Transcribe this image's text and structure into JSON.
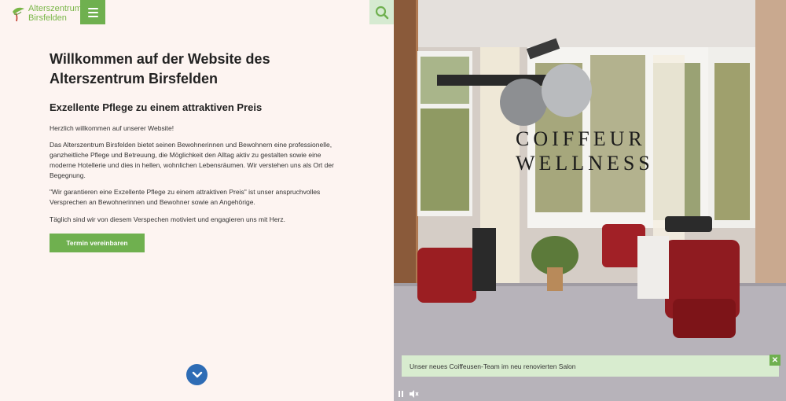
{
  "header": {
    "logo_line1": "Alterszentrum",
    "logo_line2": "Birsfelden",
    "menu_icon": "hamburger-menu-icon",
    "search_icon": "search-icon"
  },
  "main": {
    "headline": "Willkommen auf der Website des Alterszentrum Birsfelden",
    "subheadline": "Exzellente Pflege zu einem attraktiven Preis",
    "paragraphs": [
      "Herzlich willkommen auf unserer Website!",
      "Das Alterszentrum Birsfelden bietet seinen Bewohnerinnen und Bewohnern eine professionelle, ganzheitliche Pflege und Betreuung, die Möglichkeit den Alltag aktiv zu gestalten sowie eine moderne Hotellerie und dies in hellen, wohnlichen Lebensräumen. Wir verstehen uns als Ort der Begegnung.",
      "\"Wir garantieren eine Exzellente Pflege zu einem attraktiven Preis\" ist unser anspruchvolles Versprechen an Bewohnerinnen und Bewohner sowie an Angehörige.",
      "Täglich sind wir von diesem Verspechen motiviert und engagieren uns mit Herz."
    ],
    "cta_label": "Termin vereinbaren",
    "scroll_icon": "chevron-down-icon"
  },
  "hero": {
    "title_line1": "COIFFEUR",
    "title_line2": "WELLNESS",
    "caption": "Unser neues Coiffeusen-Team im neu renovierten Salon",
    "close_icon": "close-icon",
    "pause_icon": "pause-icon",
    "mute_icon": "mute-icon"
  },
  "colors": {
    "brand_green": "#6fb04f",
    "light_green": "#d6ead1",
    "background": "#fdf4f1",
    "scroll_blue": "#2e6cb5"
  }
}
